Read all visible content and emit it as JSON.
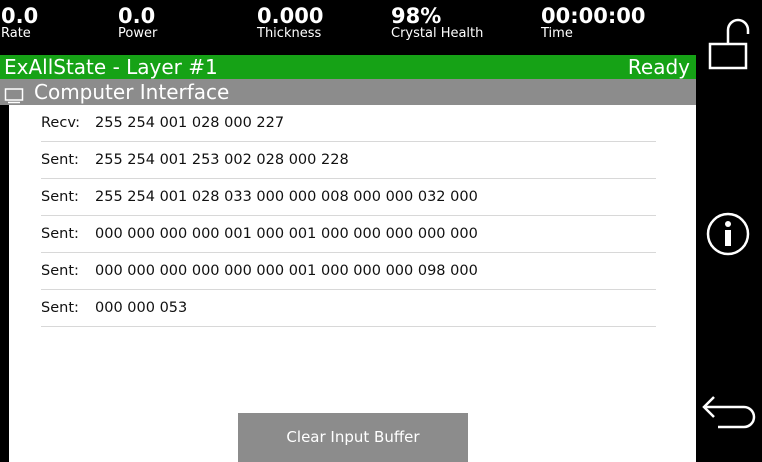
{
  "stats": [
    {
      "value": "0.0",
      "label": "Rate"
    },
    {
      "value": "0.0",
      "label": "Power"
    },
    {
      "value": "0.000",
      "label": "Thickness"
    },
    {
      "value": "98%",
      "label": "Crystal Health"
    },
    {
      "value": "00:00:00",
      "label": "Time"
    }
  ],
  "status": {
    "title": "ExAllState - Layer #1",
    "state": "Ready",
    "color": "#16a216"
  },
  "section": {
    "title": "Computer Interface",
    "icon": "monitor-icon"
  },
  "log": [
    {
      "kind": "Recv:",
      "data": "255 254 001 028 000 227"
    },
    {
      "kind": "Sent:",
      "data": "255 254 001 253 002 028 000 228"
    },
    {
      "kind": "Sent:",
      "data": "255 254 001 028 033 000 000 008 000 000 032 000"
    },
    {
      "kind": "Sent:",
      "data": "000 000 000 000 001 000 001 000 000 000 000 000"
    },
    {
      "kind": "Sent:",
      "data": "000 000 000 000 000 000 001 000 000 000 098 000"
    },
    {
      "kind": "Sent:",
      "data": "000 000 053"
    }
  ],
  "button": {
    "label": "Clear Input Buffer"
  },
  "side": {
    "icons": [
      "lock-open-icon",
      "info-icon",
      "back-arrow-icon"
    ]
  }
}
